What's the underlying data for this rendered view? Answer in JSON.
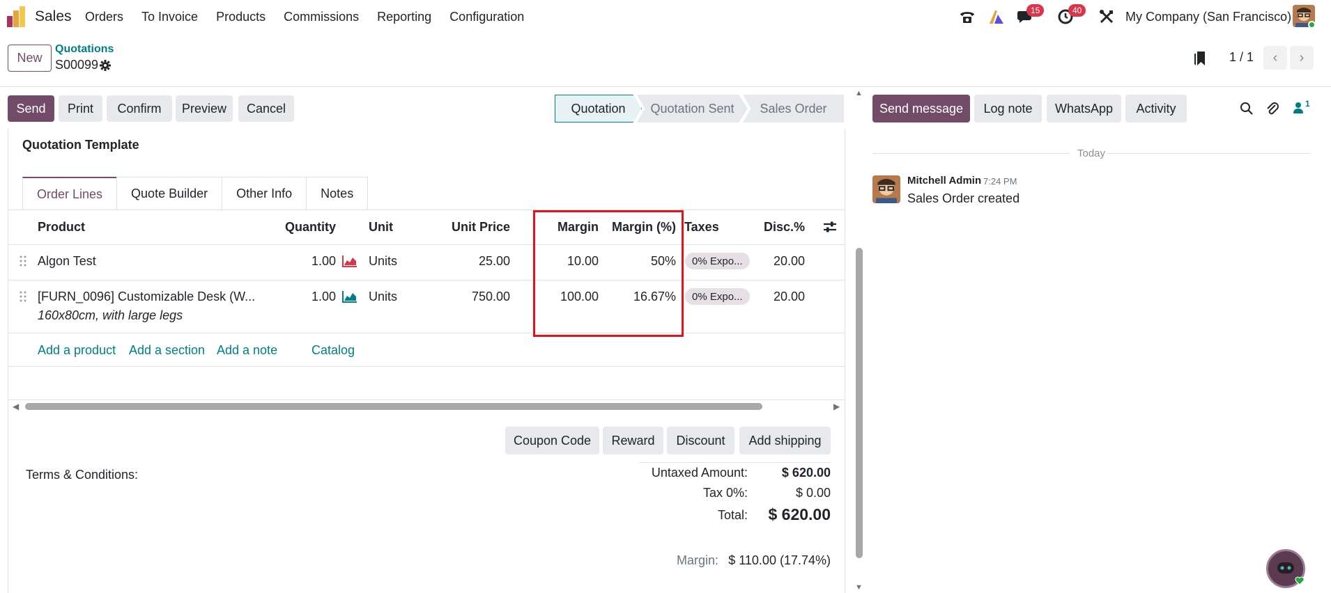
{
  "navbar": {
    "app_name": "Sales",
    "menu": [
      "Orders",
      "To Invoice",
      "Products",
      "Commissions",
      "Reporting",
      "Configuration"
    ],
    "messages_badge": "15",
    "activities_badge": "40",
    "company": "My Company (San Francisco)"
  },
  "control_panel": {
    "new_label": "New",
    "breadcrumb_parent": "Quotations",
    "breadcrumb_current": "S00099",
    "pager": "1 / 1"
  },
  "actions": {
    "send": "Send",
    "print": "Print",
    "confirm": "Confirm",
    "preview": "Preview",
    "cancel": "Cancel"
  },
  "statusbar": {
    "quotation": "Quotation",
    "quotation_sent": "Quotation Sent",
    "sales_order": "Sales Order"
  },
  "form": {
    "quotation_template_label": "Quotation Template",
    "tabs": [
      "Order Lines",
      "Quote Builder",
      "Other Info",
      "Notes"
    ],
    "columns": {
      "product": "Product",
      "quantity": "Quantity",
      "unit": "Unit",
      "unit_price": "Unit Price",
      "margin": "Margin",
      "margin_pct": "Margin (%)",
      "taxes": "Taxes",
      "disc": "Disc.%"
    },
    "lines": [
      {
        "product": "Algon Test",
        "description": "",
        "quantity": "1.00",
        "unit": "Units",
        "unit_price": "25.00",
        "margin": "10.00",
        "margin_pct": "50%",
        "tax": "0% Expo...",
        "disc": "20.00"
      },
      {
        "product": "[FURN_0096] Customizable Desk (W...",
        "description": "160x80cm, with large legs",
        "quantity": "1.00",
        "unit": "Units",
        "unit_price": "750.00",
        "margin": "100.00",
        "margin_pct": "16.67%",
        "tax": "0% Expo...",
        "disc": "20.00"
      }
    ],
    "add_links": {
      "add_product": "Add a product",
      "add_section": "Add a section",
      "add_note": "Add a note",
      "catalog": "Catalog"
    },
    "bottom_buttons": {
      "coupon": "Coupon Code",
      "reward": "Reward",
      "discount": "Discount",
      "shipping": "Add shipping"
    },
    "terms_label": "Terms & Conditions:",
    "totals": {
      "untaxed_label": "Untaxed Amount:",
      "untaxed_value": "$ 620.00",
      "tax_label": "Tax 0%:",
      "tax_value": "$ 0.00",
      "total_label": "Total:",
      "total_value": "$ 620.00",
      "margin_label": "Margin:",
      "margin_value": "$ 110.00 (17.74%)"
    }
  },
  "chatter": {
    "send_message": "Send message",
    "log_note": "Log note",
    "whatsapp": "WhatsApp",
    "activity": "Activity",
    "followers_count": "1",
    "today": "Today",
    "message": {
      "author": "Mitchell Admin",
      "time": "7:24 PM",
      "body": "Sales Order created"
    }
  },
  "colors": {
    "brand": "#714b67",
    "link": "#017e84",
    "highlight": "#e3131b"
  }
}
